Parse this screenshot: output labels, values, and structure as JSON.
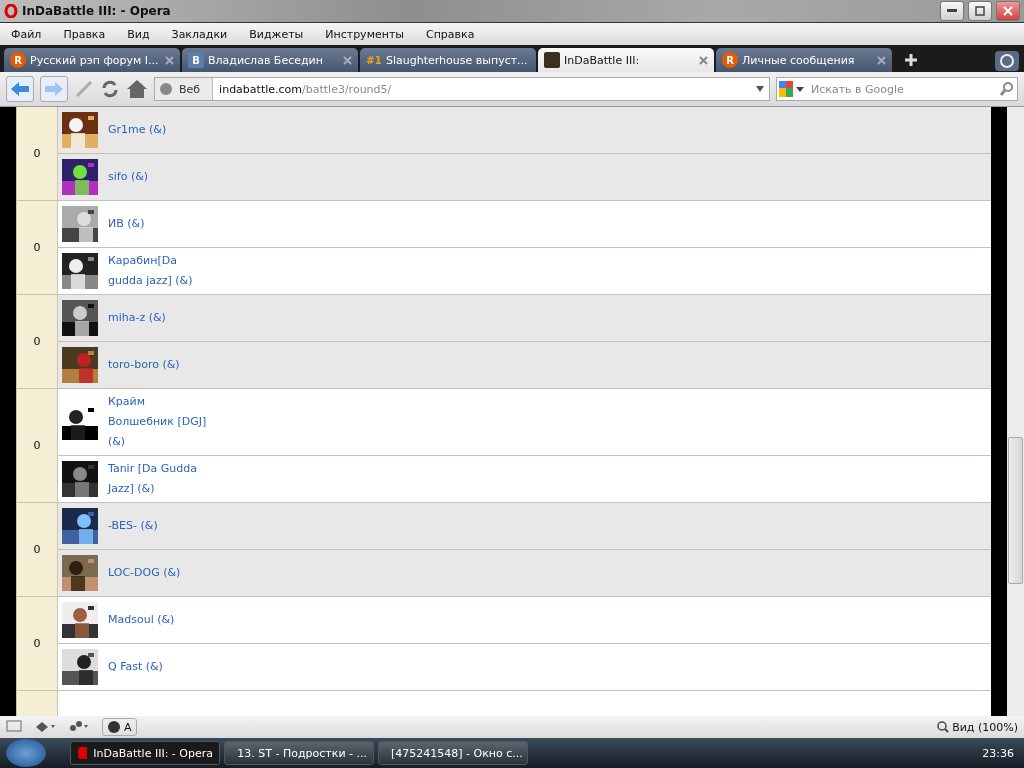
{
  "window": {
    "title": "InDaBattle III: - Opera"
  },
  "menu": [
    "Файл",
    "Правка",
    "Вид",
    "Закладки",
    "Виджеты",
    "Инструменты",
    "Справка"
  ],
  "tabs": [
    {
      "label": "Русский рэп форум I...",
      "selected": false,
      "kind": "forum",
      "icon_text": "R"
    },
    {
      "label": "Владислав Беседин",
      "selected": false,
      "kind": "social",
      "icon_text": "B"
    },
    {
      "label": "Slaughterhouse выпуст...",
      "selected": false,
      "kind": "rank",
      "icon_text": "#1"
    },
    {
      "label": "InDaBattle III:",
      "selected": true,
      "kind": "site"
    },
    {
      "label": "Личные сообщения",
      "selected": false,
      "kind": "forum",
      "icon_text": "R"
    }
  ],
  "address": {
    "scope": "Веб",
    "host": "indabattle.com",
    "path": "/battle3/round5/"
  },
  "search": {
    "placeholder": "Искать в Google"
  },
  "groups": [
    {
      "score": "0",
      "shaded": true,
      "entries": [
        {
          "lines": [
            "Gr1me (&)"
          ]
        },
        {
          "lines": [
            "sifo (&)"
          ]
        }
      ]
    },
    {
      "score": "0",
      "shaded": false,
      "entries": [
        {
          "lines": [
            "ИВ (&)"
          ]
        },
        {
          "lines": [
            "Карабин[Da",
            "gudda jazz] (&)"
          ]
        }
      ]
    },
    {
      "score": "0",
      "shaded": true,
      "entries": [
        {
          "lines": [
            "miha-z (&)"
          ]
        },
        {
          "lines": [
            "toro-boro (&)"
          ]
        }
      ]
    },
    {
      "score": "0",
      "shaded": false,
      "entries": [
        {
          "lines": [
            "Крайм",
            "Волшебник [DGJ]",
            "(&)"
          ]
        },
        {
          "lines": [
            "Tanir [Da Gudda",
            "Jazz] (&)"
          ]
        }
      ]
    },
    {
      "score": "0",
      "shaded": true,
      "entries": [
        {
          "lines": [
            "-BES- (&)"
          ]
        },
        {
          "lines": [
            "LOC-DOG (&)"
          ]
        }
      ]
    },
    {
      "score": "0",
      "shaded": false,
      "entries": [
        {
          "lines": [
            "Madsoul (&)"
          ]
        },
        {
          "lines": [
            "Q Fast (&)"
          ]
        }
      ]
    }
  ],
  "status_bar": {
    "speed_dial": "A",
    "zoom": "Вид (100%)"
  },
  "taskbar": {
    "items": [
      {
        "label": "InDaBattle III: - Opera",
        "selected": true
      },
      {
        "label": "13. ST - Подростки - ...",
        "selected": false
      },
      {
        "label": "[475241548] - Окно с...",
        "selected": false
      }
    ],
    "clock": "23:36"
  }
}
